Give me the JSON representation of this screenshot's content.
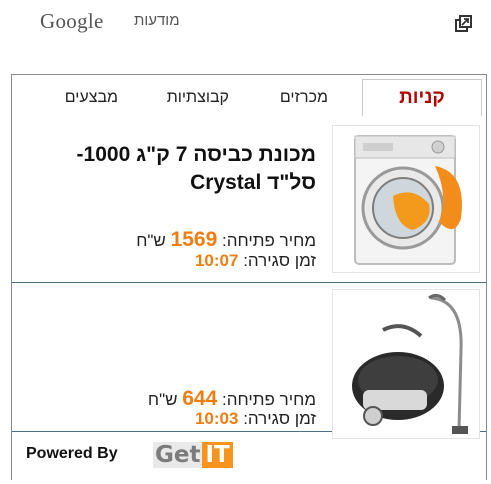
{
  "header": {
    "google_label": "Google",
    "ads_label": "מודעות",
    "popout_icon": "external-link-icon"
  },
  "tabs": [
    {
      "label": "קניות",
      "active": true
    },
    {
      "label": "מכרזים",
      "active": false
    },
    {
      "label": "קבוצתיות",
      "active": false
    },
    {
      "label": "מבצעים",
      "active": false
    }
  ],
  "items": [
    {
      "title": "מכונת כביסה 7 ק\"ג 1000- סל\"ד Crystal",
      "price_label": "מחיר פתיחה:",
      "price_value": "1569",
      "currency": "ש\"ח",
      "closing_label": "זמן סגירה:",
      "closing_time": "10:07",
      "image": "washing-machine-image"
    },
    {
      "title": "",
      "price_label": "מחיר פתיחה:",
      "price_value": "644",
      "currency": "ש\"ח",
      "closing_label": "זמן סגירה:",
      "closing_time": "10:03",
      "image": "vacuum-cleaner-image"
    }
  ],
  "footer": {
    "powered_by": "Powered By",
    "brand_get": "Get",
    "brand_it": "IT"
  },
  "colors": {
    "active_tab": "#b30000",
    "accent_orange": "#f07d12",
    "divider": "#4d6f86"
  }
}
